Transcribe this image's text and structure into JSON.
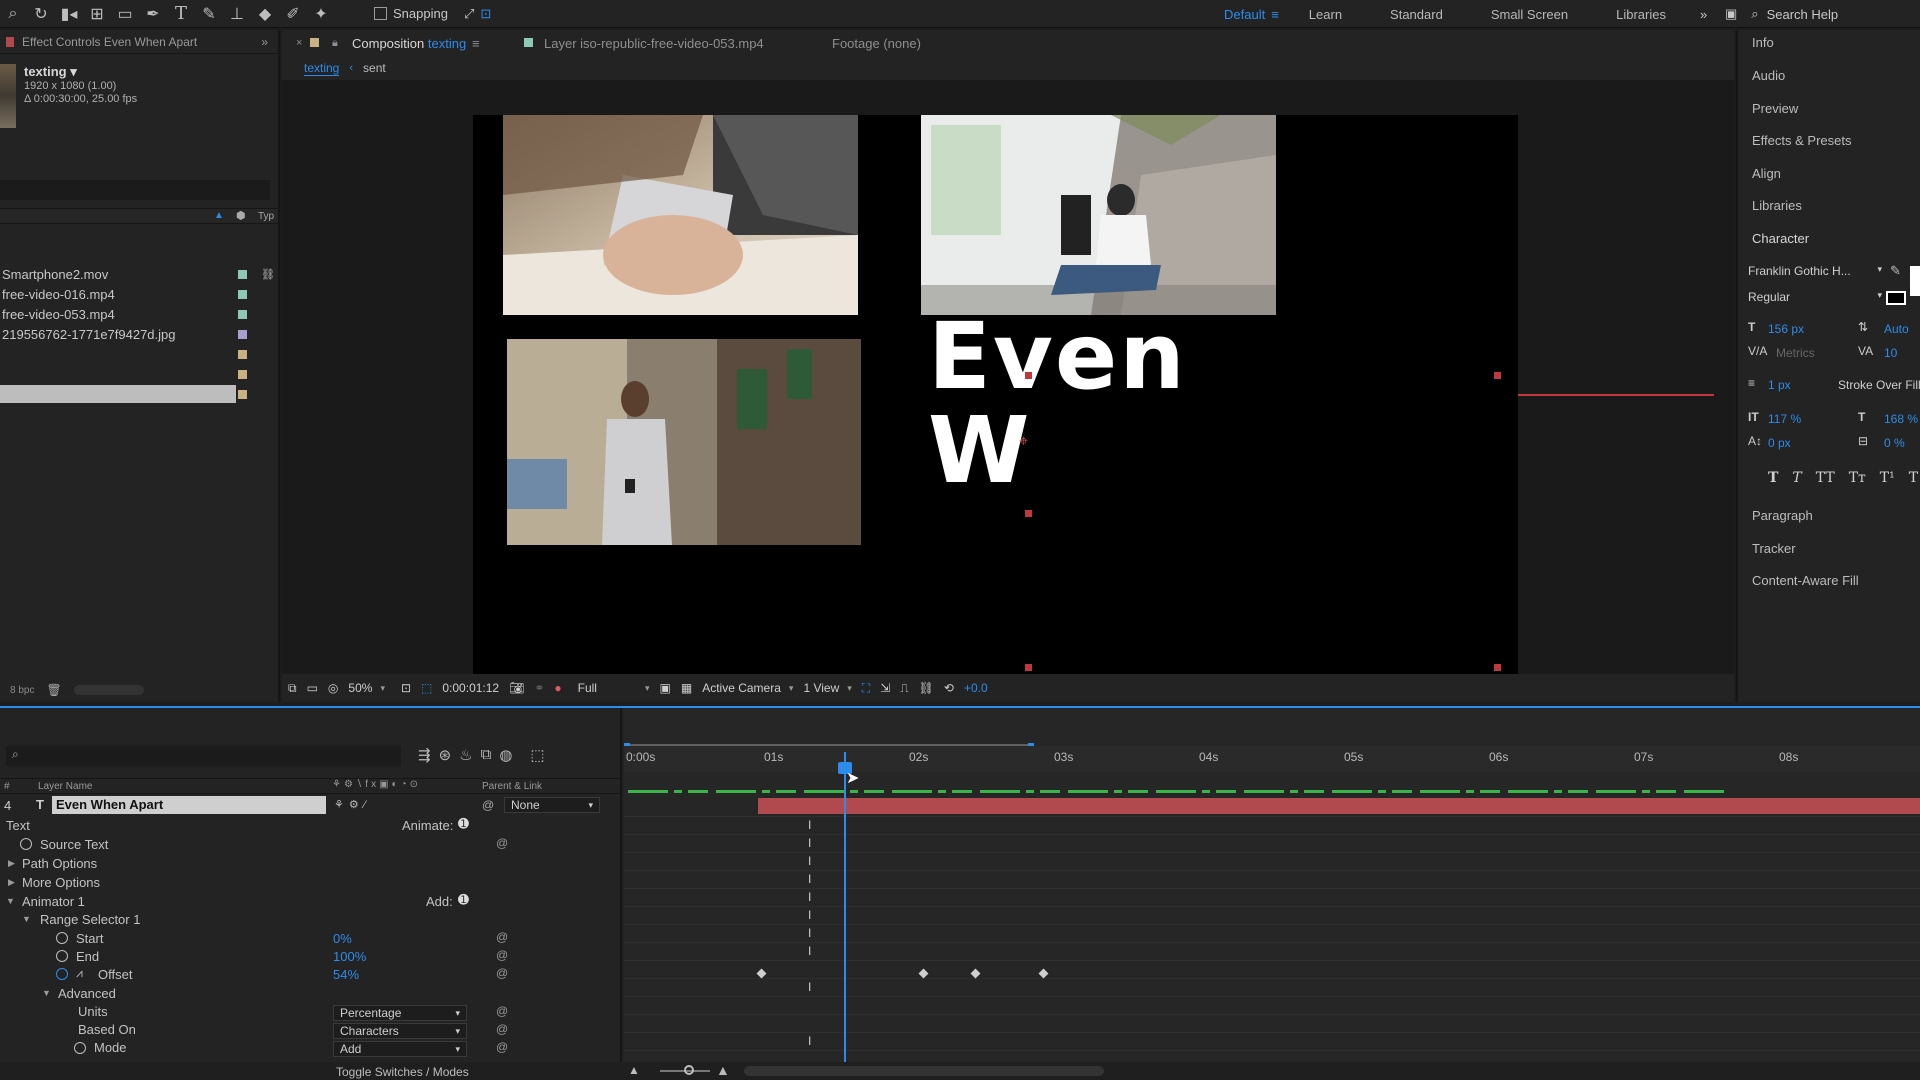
{
  "toolbar": {
    "snapping_label": "Snapping",
    "workspaces": [
      "Default",
      "Learn",
      "Standard",
      "Small Screen",
      "Libraries"
    ],
    "active_workspace": "Default",
    "search_placeholder": "Search Help"
  },
  "left_panel": {
    "tab_label": "Effect Controls Even When Apart",
    "comp_name": "texting",
    "comp_size": "1920 x 1080 (1.00)",
    "comp_duration": "Δ 0:00:30:00, 25.00 fps",
    "type_header": "Typ",
    "items": [
      {
        "name": "Smartphone2.mov",
        "color": "#8fc9b3"
      },
      {
        "name": "free-video-016.mp4",
        "color": "#8fc9b3"
      },
      {
        "name": "free-video-053.mp4",
        "color": "#8fc9b3"
      },
      {
        "name": "219556762-1771e7f9427d.jpg",
        "color": "#a8a0cc"
      },
      {
        "name": "",
        "color": "#c8b183"
      },
      {
        "name": "",
        "color": "#c8b183"
      },
      {
        "name": "",
        "color": "#c8b183"
      }
    ],
    "bpc": "8 bpc"
  },
  "viewer": {
    "tab_composition": "Composition",
    "tab_composition_name": "texting",
    "tab_layer": "Layer iso-republic-free-video-053.mp4",
    "tab_footage": "Footage (none)",
    "breadcrumb_active": "texting",
    "breadcrumb_next": "sent",
    "text_line1": "Even",
    "text_line2": "W",
    "zoom": "50%",
    "timecode": "0:00:01:12",
    "resolution": "Full",
    "camera": "Active Camera",
    "views": "1 View",
    "exposure": "+0.0"
  },
  "right_panel": {
    "items": [
      "Info",
      "Audio",
      "Preview",
      "Effects & Presets",
      "Align",
      "Libraries",
      "Character"
    ],
    "font": "Franklin Gothic H...",
    "style": "Regular",
    "font_size": "156 px",
    "leading": "Auto",
    "kerning": "Metrics",
    "tracking": "10",
    "stroke_width": "1 px",
    "stroke_type": "Stroke Over Fill",
    "vscale": "117 %",
    "hscale": "168 %",
    "baseline": "0 px",
    "tsume": "0 %",
    "type_buttons": [
      "T",
      "T",
      "TT",
      "Tт",
      "T¹",
      "T"
    ],
    "lower_items": [
      "Paragraph",
      "Tracker",
      "Content-Aware Fill"
    ]
  },
  "timeline": {
    "col_layer_name": "Layer Name",
    "col_parent": "Parent & Link",
    "layer_index": "4",
    "layer_name": "Even When Apart",
    "parent_value": "None",
    "ruler": [
      "0:00s",
      "01s",
      "02s",
      "03s",
      "04s",
      "05s",
      "06s",
      "07s",
      "08s"
    ],
    "props": {
      "text": "Text",
      "animate": "Animate:",
      "source_text": "Source Text",
      "path_options": "Path Options",
      "more_options": "More Options",
      "animator": "Animator 1",
      "add": "Add:",
      "range_selector": "Range Selector 1",
      "start": "Start",
      "start_val": "0%",
      "end": "End",
      "end_val": "100%",
      "offset": "Offset",
      "offset_val": "54%",
      "advanced": "Advanced",
      "units": "Units",
      "units_val": "Percentage",
      "based_on": "Based On",
      "based_on_val": "Characters",
      "mode": "Mode",
      "mode_val": "Add"
    },
    "footer_label": "Toggle Switches / Modes"
  },
  "colors": {
    "accent": "#2d8ceb",
    "layer_bar": "#b14a4f",
    "audio_green": "#3bb54a",
    "handle_red": "#c0383c"
  }
}
